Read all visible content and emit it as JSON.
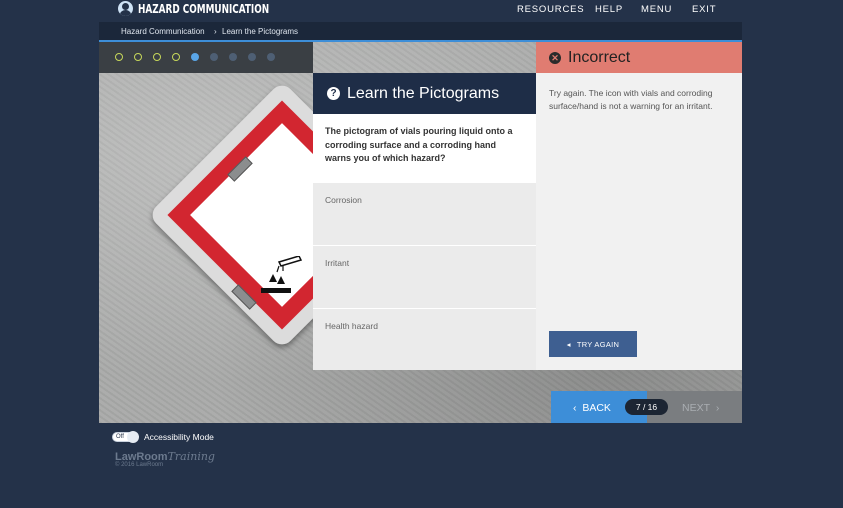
{
  "header": {
    "brand": "HAZARD COMMUNICATION",
    "nav": [
      "RESOURCES",
      "HELP",
      "MENU",
      "EXIT"
    ]
  },
  "breadcrumb": {
    "course": "Hazard Communication",
    "separator": "›",
    "page": "Learn the Pictograms"
  },
  "progress": {
    "done": 4,
    "current": 1,
    "remaining": 4,
    "done_color": "#c7d85a",
    "current_color": "#5aa6e8"
  },
  "question": {
    "title": "Learn the Pictograms",
    "text": "The pictogram of vials pouring liquid onto a corroding surface and a corroding hand warns you of which hazard?",
    "options": [
      "Corrosion",
      "Irritant",
      "Health hazard"
    ]
  },
  "feedback": {
    "title": "Incorrect",
    "text": "Try again. The icon with vials and corroding surface/hand is not a warning for an irritant.",
    "try_again": "TRY AGAIN"
  },
  "navigation": {
    "back": "BACK",
    "next": "NEXT",
    "counter": "7 / 16"
  },
  "footer": {
    "toggle_state": "Off",
    "accessibility": "Accessibility Mode",
    "logo_main": "LawRoom",
    "logo_sub": "Training",
    "copyright": "© 2016 LawRoom"
  },
  "colors": {
    "background": "#243249",
    "accent": "#3d8ed8",
    "incorrect": "#e07c71",
    "sign_red": "#d22630"
  }
}
